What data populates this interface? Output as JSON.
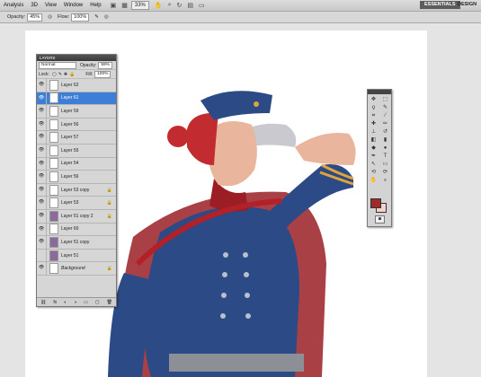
{
  "menubar": {
    "items": [
      "Analysis",
      "3D",
      "View",
      "Window",
      "Help"
    ],
    "zoom": "33%",
    "workspaces": [
      "ESSENTIALS",
      "DESIGN"
    ]
  },
  "options": {
    "opacity_label": "Opacity:",
    "opacity_value": "45%",
    "flow_label": "Flow:",
    "flow_value": "100%"
  },
  "layers_panel": {
    "title": "LAYERS",
    "blend_mode": "Normal",
    "opacity_label": "Opacity:",
    "opacity_value": "59%",
    "lock_label": "Lock:",
    "fill_label": "Fill:",
    "fill_value": "100%",
    "layers": [
      {
        "name": "Layer 62",
        "visible": true,
        "active": false
      },
      {
        "name": "Layer 61",
        "visible": true,
        "active": true
      },
      {
        "name": "Layer 59",
        "visible": true,
        "active": false
      },
      {
        "name": "Layer 56",
        "visible": true,
        "active": false
      },
      {
        "name": "Layer 57",
        "visible": true,
        "active": false
      },
      {
        "name": "Layer 55",
        "visible": true,
        "active": false
      },
      {
        "name": "Layer 54",
        "visible": true,
        "active": false
      },
      {
        "name": "Layer 56",
        "visible": true,
        "active": false
      },
      {
        "name": "Layer 53 copy",
        "visible": true,
        "active": false
      },
      {
        "name": "Layer 53",
        "visible": true,
        "active": false
      },
      {
        "name": "Layer 51 copy 2",
        "visible": true,
        "active": false
      },
      {
        "name": "Layer 60",
        "visible": true,
        "active": false
      },
      {
        "name": "Layer 51 copy",
        "visible": true,
        "active": false
      },
      {
        "name": "Layer 51",
        "visible": false,
        "active": false
      },
      {
        "name": "Background",
        "visible": true,
        "active": false
      }
    ]
  },
  "colors": {
    "foreground": "#9e2a2b",
    "background": "#f4d3c6",
    "uniform": "#2c4a86",
    "hair": "#c22b2f",
    "skin": "#e9b59c",
    "gold": "#e0a53a"
  }
}
